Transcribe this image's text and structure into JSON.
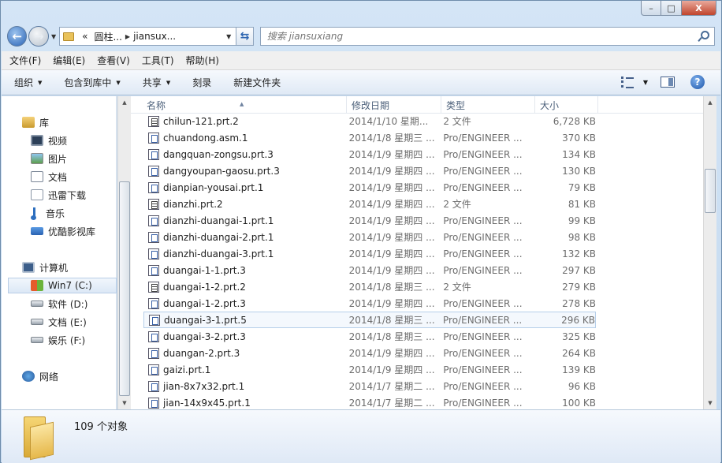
{
  "window": {
    "caption_min": "–",
    "caption_max": "□",
    "caption_close": "X"
  },
  "address": {
    "overflow": "«",
    "crumbs": [
      "圆柱...",
      "jiansux..."
    ]
  },
  "search": {
    "placeholder": "搜索 jiansuxiang"
  },
  "menu": [
    "文件(F)",
    "编辑(E)",
    "查看(V)",
    "工具(T)",
    "帮助(H)"
  ],
  "commands": {
    "organize": "组织",
    "include": "包含到库中",
    "share": "共享",
    "burn": "刻录",
    "new_folder": "新建文件夹",
    "help": "?"
  },
  "nav": {
    "library": "库",
    "videos": "视频",
    "pictures": "图片",
    "documents": "文档",
    "thunder": "迅雷下载",
    "music": "音乐",
    "youku": "优酷影视库",
    "computer": "计算机",
    "win7": "Win7 (C:)",
    "soft": "软件 (D:)",
    "docs_e": "文档 (E:)",
    "fun": "娱乐 (F:)",
    "network": "网络"
  },
  "columns": {
    "name": "名称",
    "date": "修改日期",
    "type": "类型",
    "size": "大小"
  },
  "files": [
    {
      "name": "chilun-121.prt.2",
      "date": "2014/1/10 星期...",
      "type": "2 文件",
      "size": "6,728 KB",
      "icon": "generic-file-icon"
    },
    {
      "name": "chuandong.asm.1",
      "date": "2014/1/8 星期三 ...",
      "type": "Pro/ENGINEER ...",
      "size": "370 KB",
      "icon": "proe-file-icon"
    },
    {
      "name": "dangquan-zongsu.prt.3",
      "date": "2014/1/9 星期四 ...",
      "type": "Pro/ENGINEER ...",
      "size": "134 KB",
      "icon": "proe-file-icon"
    },
    {
      "name": "dangyoupan-gaosu.prt.3",
      "date": "2014/1/9 星期四 ...",
      "type": "Pro/ENGINEER ...",
      "size": "130 KB",
      "icon": "proe-file-icon"
    },
    {
      "name": "dianpian-yousai.prt.1",
      "date": "2014/1/9 星期四 ...",
      "type": "Pro/ENGINEER ...",
      "size": "79 KB",
      "icon": "proe-file-icon"
    },
    {
      "name": "dianzhi.prt.2",
      "date": "2014/1/9 星期四 ...",
      "type": "2 文件",
      "size": "81 KB",
      "icon": "generic-file-icon"
    },
    {
      "name": "dianzhi-duangai-1.prt.1",
      "date": "2014/1/9 星期四 ...",
      "type": "Pro/ENGINEER ...",
      "size": "99 KB",
      "icon": "proe-file-icon"
    },
    {
      "name": "dianzhi-duangai-2.prt.1",
      "date": "2014/1/9 星期四 ...",
      "type": "Pro/ENGINEER ...",
      "size": "98 KB",
      "icon": "proe-file-icon"
    },
    {
      "name": "dianzhi-duangai-3.prt.1",
      "date": "2014/1/9 星期四 ...",
      "type": "Pro/ENGINEER ...",
      "size": "132 KB",
      "icon": "proe-file-icon"
    },
    {
      "name": "duangai-1-1.prt.3",
      "date": "2014/1/9 星期四 ...",
      "type": "Pro/ENGINEER ...",
      "size": "297 KB",
      "icon": "proe-file-icon"
    },
    {
      "name": "duangai-1-2.prt.2",
      "date": "2014/1/8 星期三 ...",
      "type": "2 文件",
      "size": "279 KB",
      "icon": "generic-file-icon"
    },
    {
      "name": "duangai-1-2.prt.3",
      "date": "2014/1/9 星期四 ...",
      "type": "Pro/ENGINEER ...",
      "size": "278 KB",
      "icon": "proe-file-icon"
    },
    {
      "name": "duangai-3-1.prt.5",
      "date": "2014/1/8 星期三 ...",
      "type": "Pro/ENGINEER ...",
      "size": "296 KB",
      "icon": "proe-file-icon"
    },
    {
      "name": "duangai-3-2.prt.3",
      "date": "2014/1/8 星期三 ...",
      "type": "Pro/ENGINEER ...",
      "size": "325 KB",
      "icon": "proe-file-icon"
    },
    {
      "name": "duangan-2.prt.3",
      "date": "2014/1/9 星期四 ...",
      "type": "Pro/ENGINEER ...",
      "size": "264 KB",
      "icon": "proe-file-icon"
    },
    {
      "name": "gaizi.prt.1",
      "date": "2014/1/9 星期四 ...",
      "type": "Pro/ENGINEER ...",
      "size": "139 KB",
      "icon": "proe-file-icon"
    },
    {
      "name": "jian-8x7x32.prt.1",
      "date": "2014/1/7 星期二 ...",
      "type": "Pro/ENGINEER ...",
      "size": "96 KB",
      "icon": "proe-file-icon"
    },
    {
      "name": "jian-14x9x45.prt.1",
      "date": "2014/1/7 星期二 ...",
      "type": "Pro/ENGINEER ...",
      "size": "100 KB",
      "icon": "proe-file-icon"
    }
  ],
  "status": {
    "count": "109 个对象"
  }
}
